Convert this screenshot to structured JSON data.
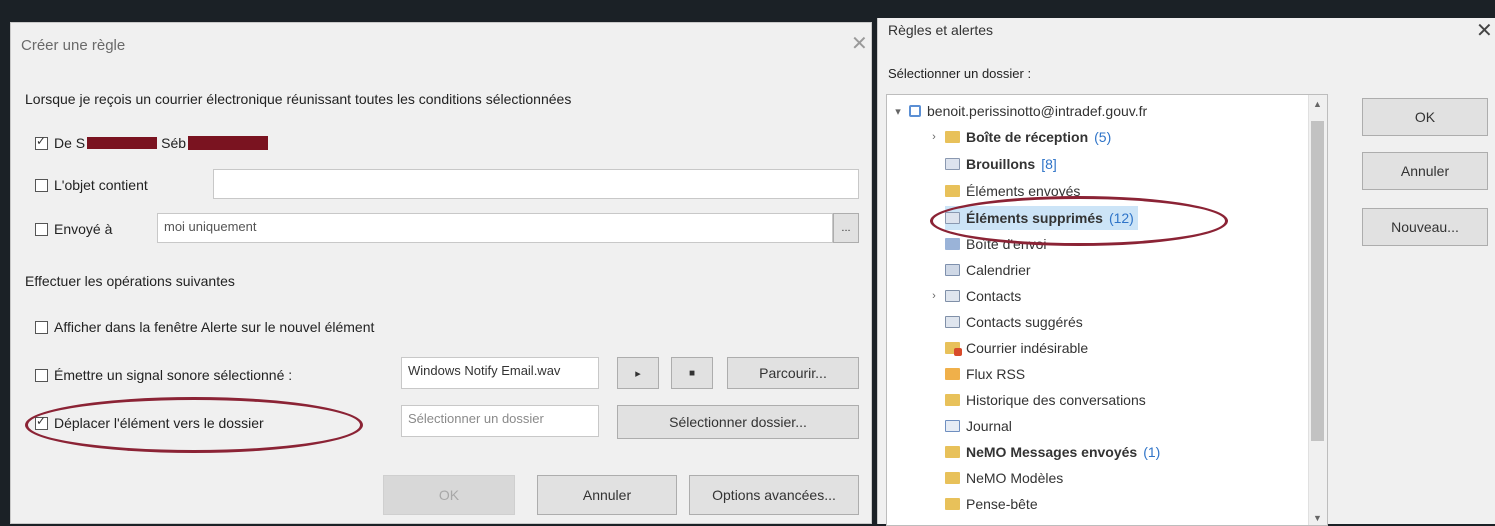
{
  "rule_dialog": {
    "title": "Créer une règle",
    "close_glyph": "✕",
    "conditions_heading": "Lorsque je reçois un courrier électronique réunissant toutes les conditions sélectionnées",
    "from": {
      "label_prefix": "De S",
      "label_mid": "Séb",
      "checked": true
    },
    "subject": {
      "label": "L'objet contient",
      "value": "",
      "checked": false
    },
    "sent_to": {
      "label": "Envoyé à",
      "value": "moi uniquement",
      "checked": false,
      "button": "..."
    },
    "actions_heading": "Effectuer les opérations suivantes",
    "alert": {
      "label": "Afficher dans la fenêtre Alerte sur le nouvel élément",
      "checked": false
    },
    "sound": {
      "label": "Émettre un signal sonore sélectionné :",
      "value": "Windows Notify Email.wav",
      "play": "▸",
      "stop": "■",
      "browse": "Parcourir...",
      "checked": false
    },
    "move": {
      "label": "Déplacer l'élément vers le dossier",
      "value": "Sélectionner un dossier",
      "select_button": "Sélectionner dossier...",
      "checked": true
    },
    "buttons": {
      "ok": "OK",
      "cancel": "Annuler",
      "advanced": "Options avancées..."
    }
  },
  "folder_dialog": {
    "title": "Règles et alertes",
    "close_glyph": "✕",
    "prompt": "Sélectionner un dossier :",
    "account": "benoit.perissinotto@intradef.gouv.fr",
    "folders": [
      {
        "name": "Boîte de réception",
        "count": "(5)",
        "bold": true,
        "icon": "inbox-folder-icon"
      },
      {
        "name": "Brouillons",
        "count": "[8]",
        "bold": true,
        "icon": "drafts-icon"
      },
      {
        "name": "Éléments envoyés",
        "count": "",
        "bold": false,
        "icon": "sent-folder-icon"
      },
      {
        "name": "Éléments supprimés",
        "count": "(12)",
        "bold": true,
        "icon": "deleted-items-icon"
      },
      {
        "name": "Boîte d'envoi",
        "count": "",
        "bold": false,
        "icon": "outbox-icon"
      },
      {
        "name": "Calendrier",
        "count": "",
        "bold": false,
        "icon": "calendar-icon"
      },
      {
        "name": "Contacts",
        "count": "",
        "bold": false,
        "icon": "contacts-icon"
      },
      {
        "name": "Contacts suggérés",
        "count": "",
        "bold": false,
        "icon": "contacts-icon"
      },
      {
        "name": "Courrier indésirable",
        "count": "",
        "bold": false,
        "icon": "junk-folder-icon"
      },
      {
        "name": "Flux RSS",
        "count": "",
        "bold": false,
        "icon": "rss-folder-icon"
      },
      {
        "name": "Historique des conversations",
        "count": "",
        "bold": false,
        "icon": "folder-icon"
      },
      {
        "name": "Journal",
        "count": "",
        "bold": false,
        "icon": "journal-icon"
      },
      {
        "name": "NeMO Messages envoyés",
        "count": "(1)",
        "bold": true,
        "icon": "folder-icon"
      },
      {
        "name": "NeMO Modèles",
        "count": "",
        "bold": false,
        "icon": "folder-icon"
      },
      {
        "name": "Pense-bête",
        "count": "",
        "bold": false,
        "icon": "folder-icon"
      }
    ],
    "buttons": {
      "ok": "OK",
      "cancel": "Annuler",
      "new": "Nouveau..."
    }
  },
  "colors": {
    "annotation": "#8b2335",
    "redaction": "#7a1320",
    "accent": "#2f74c8"
  }
}
